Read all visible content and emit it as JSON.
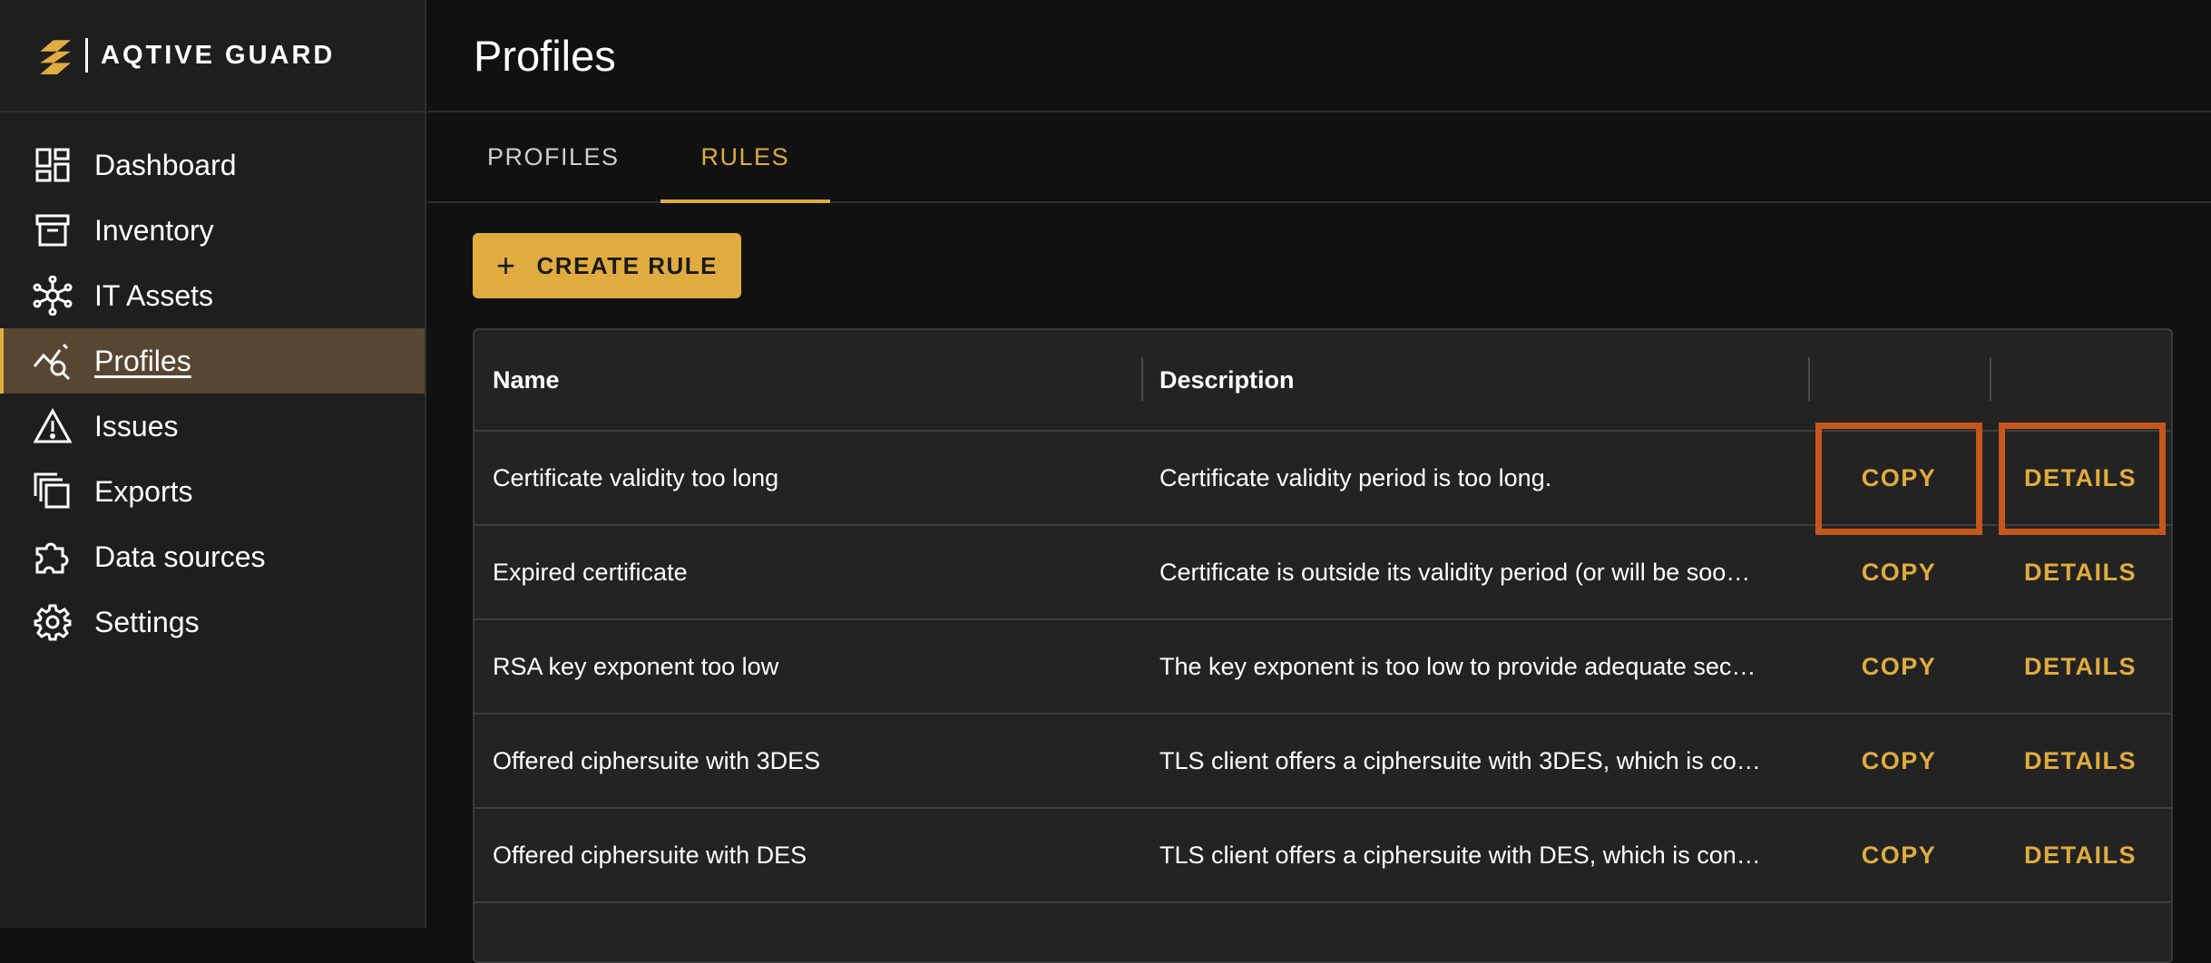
{
  "brand": {
    "name": "AQTIVE GUARD"
  },
  "nav": {
    "items": [
      {
        "label": "Dashboard",
        "icon": "dashboard-icon"
      },
      {
        "label": "Inventory",
        "icon": "archive-icon"
      },
      {
        "label": "IT Assets",
        "icon": "network-icon"
      },
      {
        "label": "Profiles",
        "icon": "profile-analytics-icon",
        "active": true
      },
      {
        "label": "Issues",
        "icon": "warning-icon"
      },
      {
        "label": "Exports",
        "icon": "copy-stack-icon"
      },
      {
        "label": "Data sources",
        "icon": "puzzle-icon"
      },
      {
        "label": "Settings",
        "icon": "gear-icon"
      }
    ]
  },
  "header": {
    "title": "Profiles"
  },
  "tabs": [
    {
      "label": "PROFILES"
    },
    {
      "label": "RULES",
      "active": true
    }
  ],
  "toolbar": {
    "create_label": "CREATE RULE"
  },
  "table": {
    "headers": {
      "name": "Name",
      "description": "Description"
    },
    "rows": [
      {
        "name": "Certificate validity too long",
        "description": "Certificate validity period is too long.",
        "copy": "COPY",
        "details": "DETAILS"
      },
      {
        "name": "Expired certificate",
        "description": "Certificate is outside its validity period (or will be soo…",
        "copy": "COPY",
        "details": "DETAILS"
      },
      {
        "name": "RSA key exponent too low",
        "description": "The key exponent is too low to provide adequate sec…",
        "copy": "COPY",
        "details": "DETAILS"
      },
      {
        "name": "Offered ciphersuite with 3DES",
        "description": "TLS client offers a ciphersuite with 3DES, which is co…",
        "copy": "COPY",
        "details": "DETAILS"
      },
      {
        "name": "Offered ciphersuite with DES",
        "description": "TLS client offers a ciphersuite with DES, which is con…",
        "copy": "COPY",
        "details": "DETAILS"
      }
    ]
  },
  "colors": {
    "accent": "#e0ac3f",
    "highlight": "#c5561c",
    "active_nav_bg": "#574732"
  }
}
